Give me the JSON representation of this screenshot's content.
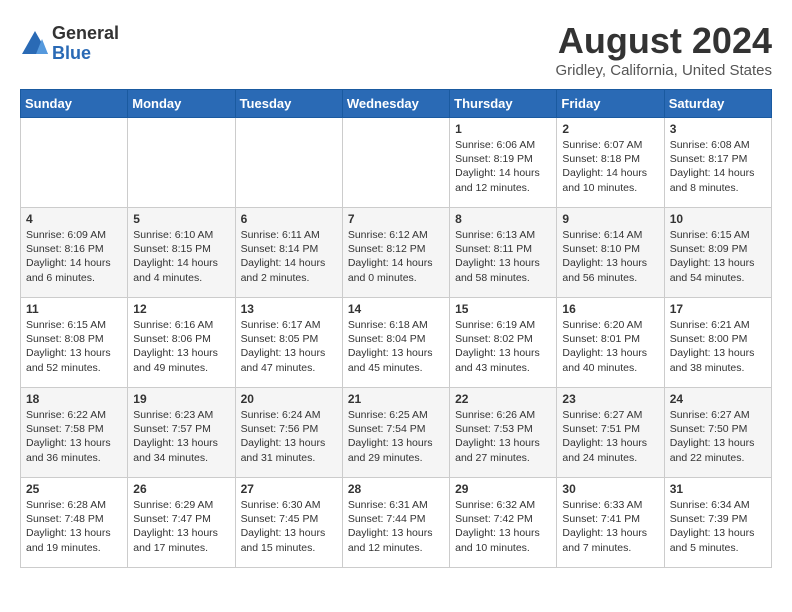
{
  "header": {
    "logo_general": "General",
    "logo_blue": "Blue",
    "title": "August 2024",
    "location": "Gridley, California, United States"
  },
  "days_of_week": [
    "Sunday",
    "Monday",
    "Tuesday",
    "Wednesday",
    "Thursday",
    "Friday",
    "Saturday"
  ],
  "weeks": [
    [
      {
        "day": "",
        "info": ""
      },
      {
        "day": "",
        "info": ""
      },
      {
        "day": "",
        "info": ""
      },
      {
        "day": "",
        "info": ""
      },
      {
        "day": "1",
        "info": "Sunrise: 6:06 AM\nSunset: 8:19 PM\nDaylight: 14 hours and 12 minutes."
      },
      {
        "day": "2",
        "info": "Sunrise: 6:07 AM\nSunset: 8:18 PM\nDaylight: 14 hours and 10 minutes."
      },
      {
        "day": "3",
        "info": "Sunrise: 6:08 AM\nSunset: 8:17 PM\nDaylight: 14 hours and 8 minutes."
      }
    ],
    [
      {
        "day": "4",
        "info": "Sunrise: 6:09 AM\nSunset: 8:16 PM\nDaylight: 14 hours and 6 minutes."
      },
      {
        "day": "5",
        "info": "Sunrise: 6:10 AM\nSunset: 8:15 PM\nDaylight: 14 hours and 4 minutes."
      },
      {
        "day": "6",
        "info": "Sunrise: 6:11 AM\nSunset: 8:14 PM\nDaylight: 14 hours and 2 minutes."
      },
      {
        "day": "7",
        "info": "Sunrise: 6:12 AM\nSunset: 8:12 PM\nDaylight: 14 hours and 0 minutes."
      },
      {
        "day": "8",
        "info": "Sunrise: 6:13 AM\nSunset: 8:11 PM\nDaylight: 13 hours and 58 minutes."
      },
      {
        "day": "9",
        "info": "Sunrise: 6:14 AM\nSunset: 8:10 PM\nDaylight: 13 hours and 56 minutes."
      },
      {
        "day": "10",
        "info": "Sunrise: 6:15 AM\nSunset: 8:09 PM\nDaylight: 13 hours and 54 minutes."
      }
    ],
    [
      {
        "day": "11",
        "info": "Sunrise: 6:15 AM\nSunset: 8:08 PM\nDaylight: 13 hours and 52 minutes."
      },
      {
        "day": "12",
        "info": "Sunrise: 6:16 AM\nSunset: 8:06 PM\nDaylight: 13 hours and 49 minutes."
      },
      {
        "day": "13",
        "info": "Sunrise: 6:17 AM\nSunset: 8:05 PM\nDaylight: 13 hours and 47 minutes."
      },
      {
        "day": "14",
        "info": "Sunrise: 6:18 AM\nSunset: 8:04 PM\nDaylight: 13 hours and 45 minutes."
      },
      {
        "day": "15",
        "info": "Sunrise: 6:19 AM\nSunset: 8:02 PM\nDaylight: 13 hours and 43 minutes."
      },
      {
        "day": "16",
        "info": "Sunrise: 6:20 AM\nSunset: 8:01 PM\nDaylight: 13 hours and 40 minutes."
      },
      {
        "day": "17",
        "info": "Sunrise: 6:21 AM\nSunset: 8:00 PM\nDaylight: 13 hours and 38 minutes."
      }
    ],
    [
      {
        "day": "18",
        "info": "Sunrise: 6:22 AM\nSunset: 7:58 PM\nDaylight: 13 hours and 36 minutes."
      },
      {
        "day": "19",
        "info": "Sunrise: 6:23 AM\nSunset: 7:57 PM\nDaylight: 13 hours and 34 minutes."
      },
      {
        "day": "20",
        "info": "Sunrise: 6:24 AM\nSunset: 7:56 PM\nDaylight: 13 hours and 31 minutes."
      },
      {
        "day": "21",
        "info": "Sunrise: 6:25 AM\nSunset: 7:54 PM\nDaylight: 13 hours and 29 minutes."
      },
      {
        "day": "22",
        "info": "Sunrise: 6:26 AM\nSunset: 7:53 PM\nDaylight: 13 hours and 27 minutes."
      },
      {
        "day": "23",
        "info": "Sunrise: 6:27 AM\nSunset: 7:51 PM\nDaylight: 13 hours and 24 minutes."
      },
      {
        "day": "24",
        "info": "Sunrise: 6:27 AM\nSunset: 7:50 PM\nDaylight: 13 hours and 22 minutes."
      }
    ],
    [
      {
        "day": "25",
        "info": "Sunrise: 6:28 AM\nSunset: 7:48 PM\nDaylight: 13 hours and 19 minutes."
      },
      {
        "day": "26",
        "info": "Sunrise: 6:29 AM\nSunset: 7:47 PM\nDaylight: 13 hours and 17 minutes."
      },
      {
        "day": "27",
        "info": "Sunrise: 6:30 AM\nSunset: 7:45 PM\nDaylight: 13 hours and 15 minutes."
      },
      {
        "day": "28",
        "info": "Sunrise: 6:31 AM\nSunset: 7:44 PM\nDaylight: 13 hours and 12 minutes."
      },
      {
        "day": "29",
        "info": "Sunrise: 6:32 AM\nSunset: 7:42 PM\nDaylight: 13 hours and 10 minutes."
      },
      {
        "day": "30",
        "info": "Sunrise: 6:33 AM\nSunset: 7:41 PM\nDaylight: 13 hours and 7 minutes."
      },
      {
        "day": "31",
        "info": "Sunrise: 6:34 AM\nSunset: 7:39 PM\nDaylight: 13 hours and 5 minutes."
      }
    ]
  ]
}
